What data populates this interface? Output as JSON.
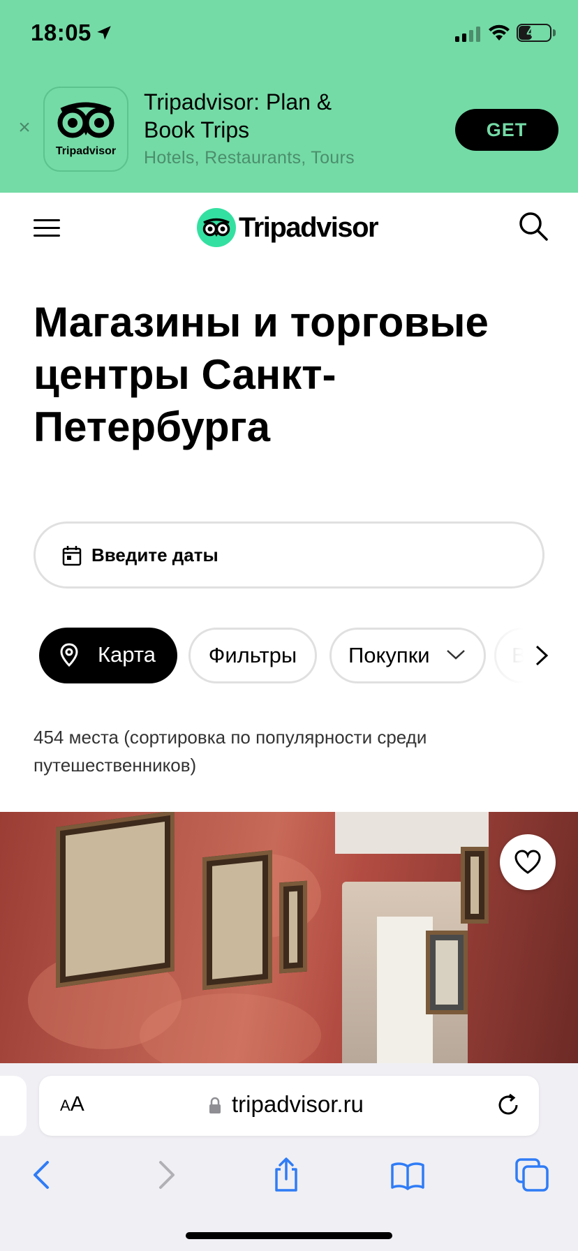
{
  "status_bar": {
    "time": "18:05",
    "battery": "41",
    "battery_level": 0.41
  },
  "app_banner": {
    "icon_label": "Tripadvisor",
    "title": "Tripadvisor: Plan & Book Trips",
    "subtitle": "Hotels, Restaurants, Tours",
    "get_label": "GET",
    "close_icon": "close-icon"
  },
  "header": {
    "logo_text": "Tripadvisor",
    "menu_icon": "hamburger-menu-icon",
    "search_icon": "search-icon"
  },
  "main": {
    "title": "Магазины и торговые центры Санкт-Петербурга",
    "date_input": {
      "label": "Введите даты",
      "icon": "calendar-icon"
    },
    "chips": {
      "map": "Карта",
      "filters": "Фильтры",
      "shopping": "Покупки",
      "more": "Вы"
    },
    "result_count": "454 места (сортировка по популярности среди путешественников)"
  },
  "safari": {
    "text_size_label": "AA",
    "url": "tripadvisor.ru",
    "toolbar": [
      "back-icon",
      "forward-icon",
      "share-icon",
      "bookmarks-icon",
      "tabs-icon"
    ]
  },
  "colors": {
    "brand_green": "#34e0a1",
    "banner_bg": "#74dba6",
    "safari_blue": "#2f7cf6"
  }
}
